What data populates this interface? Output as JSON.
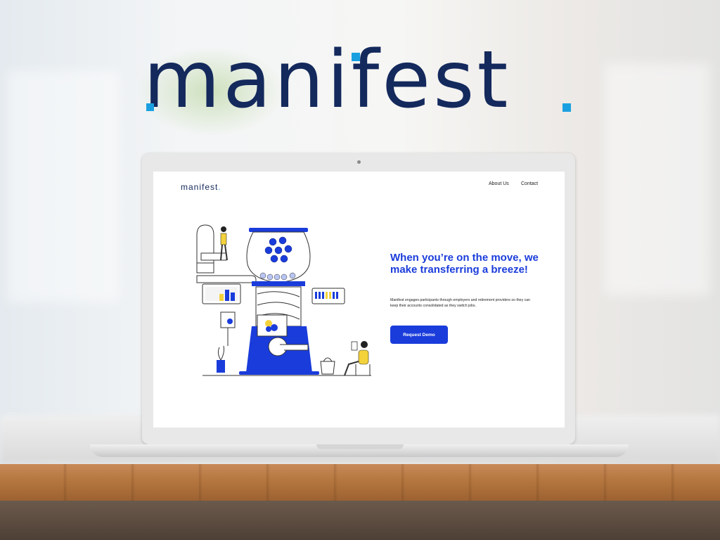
{
  "brand": {
    "name": "manifest",
    "accent_color": "#1aa0e0",
    "text_color": "#14295c"
  },
  "site": {
    "logo_text": "manifest",
    "logo_dot": ".",
    "nav": [
      "About Us",
      "Contact"
    ],
    "hero_title": "When you’re on the move, we make transferring a breeze!",
    "hero_description": "Manifest engages participants through employers and retirement providers so they can keep their accounts consolidated as they switch jobs.",
    "cta_label": "Request Demo",
    "primary_color": "#1a3cdb",
    "illustration": "gumball-machine-illustration"
  }
}
